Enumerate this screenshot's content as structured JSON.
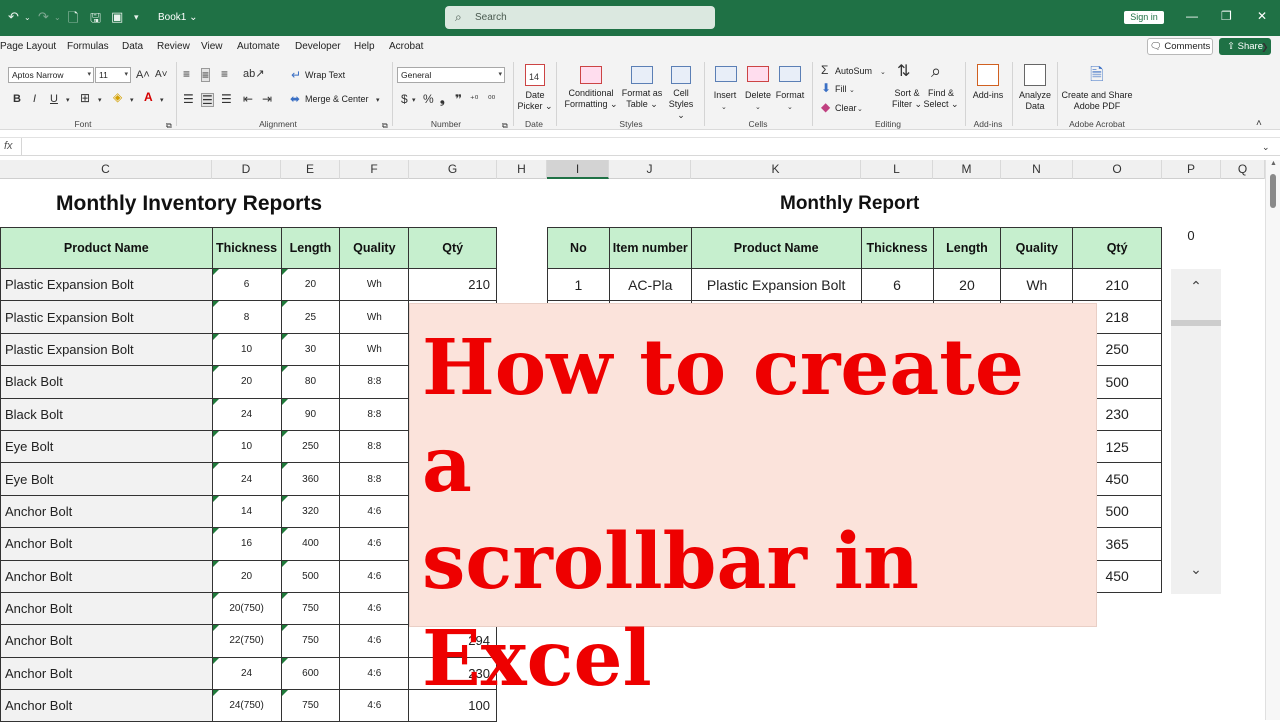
{
  "titlebar": {
    "book_title": "Book1 ⌄",
    "search_placeholder": "Search",
    "signin_label": "Sign in",
    "accent_color": "#1f7145"
  },
  "menu": {
    "items": [
      "Page Layout",
      "Formulas",
      "Data",
      "Review",
      "View",
      "Automate",
      "Developer",
      "Help",
      "Acrobat"
    ],
    "comments_label": "Comments",
    "share_label": "Share"
  },
  "ribbon": {
    "font_name": "Aptos Narrow",
    "font_size": "11",
    "number_format": "General",
    "wrap_text": "Wrap Text",
    "merge_center": "Merge & Center",
    "date_picker": [
      "Date",
      "Picker ⌄"
    ],
    "cond_format": [
      "Conditional",
      "Formatting ⌄"
    ],
    "format_table": [
      "Format as",
      "Table ⌄"
    ],
    "cell_styles": [
      "Cell",
      "Styles ⌄"
    ],
    "insert": "Insert",
    "delete": "Delete",
    "format": "Format",
    "autosum": "AutoSum",
    "fill": "Fill",
    "clear": "Clear",
    "sort_filter": [
      "Sort &",
      "Filter ⌄"
    ],
    "find_select": [
      "Find &",
      "Select ⌄"
    ],
    "add_ins": "Add-ins",
    "analyze": [
      "Analyze",
      "Data"
    ],
    "create_share": [
      "Create and Share",
      "Adobe PDF"
    ],
    "groups": {
      "font": "Font",
      "alignment": "Alignment",
      "number": "Number",
      "date": "Date",
      "styles": "Styles",
      "cells": "Cells",
      "editing": "Editing",
      "add_ins": "Add-ins",
      "acrobat": "Adobe Acrobat"
    }
  },
  "formula_bar": {
    "fx": "fx",
    "value": ""
  },
  "columns": [
    "C",
    "D",
    "E",
    "F",
    "G",
    "H",
    "I",
    "J",
    "K",
    "L",
    "M",
    "N",
    "O",
    "P",
    "Q"
  ],
  "sheet": {
    "title_left": "Monthly Inventory Reports",
    "title_right": "Monthly Report",
    "headers_left": [
      "Product Name",
      "Thickness",
      "Length",
      "Quality",
      "Qtý"
    ],
    "rows_left": [
      [
        "Plastic Expansion Bolt",
        "6",
        "20",
        "Wh",
        "210"
      ],
      [
        "Plastic Expansion Bolt",
        "8",
        "25",
        "Wh",
        ""
      ],
      [
        "Plastic Expansion Bolt",
        "10",
        "30",
        "Wh",
        ""
      ],
      [
        "Black Bolt",
        "20",
        "80",
        "8:8",
        ""
      ],
      [
        "Black Bolt",
        "24",
        "90",
        "8:8",
        ""
      ],
      [
        "Eye Bolt",
        "10",
        "250",
        "8:8",
        ""
      ],
      [
        "Eye Bolt",
        "24",
        "360",
        "8:8",
        ""
      ],
      [
        "Anchor Bolt",
        "14",
        "320",
        "4:6",
        ""
      ],
      [
        "Anchor Bolt",
        "16",
        "400",
        "4:6",
        ""
      ],
      [
        "Anchor Bolt",
        "20",
        "500",
        "4:6",
        ""
      ],
      [
        "Anchor Bolt",
        "20(750)",
        "750",
        "4:6",
        ""
      ],
      [
        "Anchor Bolt",
        "22(750)",
        "750",
        "4:6",
        "294"
      ],
      [
        "Anchor Bolt",
        "24",
        "600",
        "4:6",
        "230"
      ],
      [
        "Anchor Bolt",
        "24(750)",
        "750",
        "4:6",
        "100"
      ]
    ],
    "headers_right": [
      "No",
      "Item number",
      "Product Name",
      "Thickness",
      "Length",
      "Quality",
      "Qtý"
    ],
    "rows_right": [
      [
        "1",
        "AC-Pla",
        "Plastic Expansion Bolt",
        "6",
        "20",
        "Wh",
        "210"
      ],
      [
        "",
        "",
        "",
        "",
        "",
        "",
        "218"
      ],
      [
        "",
        "",
        "",
        "",
        "",
        "",
        "250"
      ],
      [
        "",
        "",
        "",
        "",
        "",
        "",
        "500"
      ],
      [
        "",
        "",
        "",
        "",
        "",
        "",
        "230"
      ],
      [
        "",
        "",
        "",
        "",
        "",
        "",
        "125"
      ],
      [
        "",
        "",
        "",
        "",
        "",
        "",
        "450"
      ],
      [
        "",
        "",
        "",
        "",
        "",
        "",
        "500"
      ],
      [
        "",
        "",
        "",
        "",
        "",
        "",
        "365"
      ],
      [
        "",
        "",
        "",
        "",
        "",
        "",
        "450"
      ]
    ],
    "p_value": "0",
    "scrollbar_value": 0
  },
  "overlay": {
    "text": "How to create a\nscrollbar in\nExcel",
    "color": "#ee0000"
  }
}
